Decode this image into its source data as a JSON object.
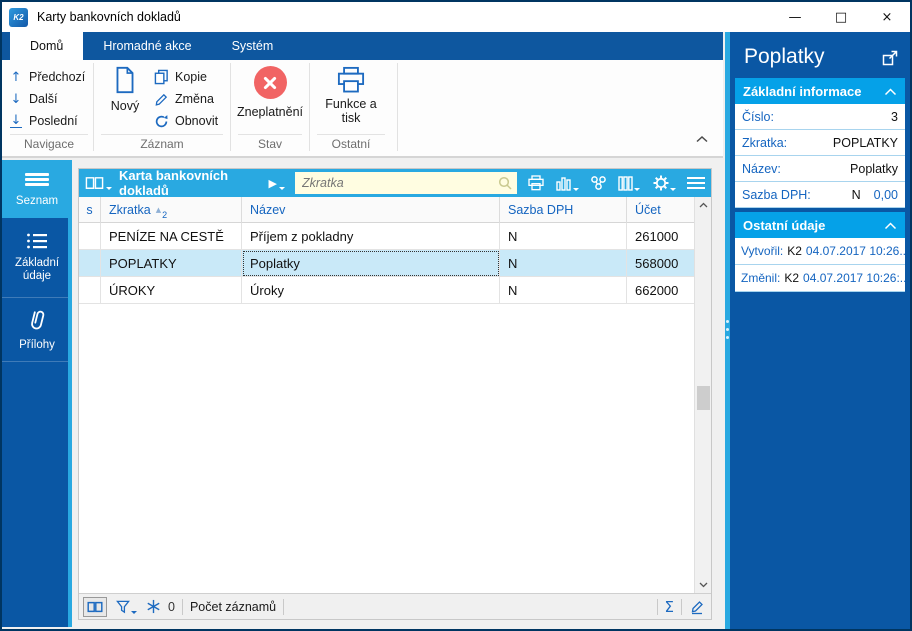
{
  "window": {
    "title": "Karty bankovních dokladů",
    "app_badge": "K2",
    "controls": {
      "minimize": "—",
      "maximize": "□",
      "close": "×"
    }
  },
  "ribbon": {
    "tabs": [
      {
        "label": "Domů"
      },
      {
        "label": "Hromadné akce"
      },
      {
        "label": "Systém"
      }
    ],
    "navigace": {
      "label": "Navigace",
      "prev": "Předchozí",
      "next": "Další",
      "last": "Poslední",
      "arrow_up": "↑",
      "arrow_down": "↓"
    },
    "zaznam": {
      "label": "Záznam",
      "new": "Nový",
      "copy": "Kopie",
      "change": "Změna",
      "refresh": "Obnovit"
    },
    "stav": {
      "label": "Stav",
      "invalidate": "Zneplatnění"
    },
    "ostatni": {
      "label": "Ostatní",
      "functions_line1": "Funkce a",
      "functions_line2": "tisk"
    }
  },
  "sidebar": {
    "items": [
      {
        "label": "Seznam",
        "icon": "hamburger-icon",
        "active": true
      },
      {
        "line1": "Základní",
        "line2": "údaje",
        "icon": "list-icon"
      },
      {
        "label": "Přílohy",
        "icon": "paperclip-icon"
      }
    ]
  },
  "grid": {
    "title": "Karta bankovních dokladů",
    "play_glyph": "▶",
    "search_placeholder": "Zkratka",
    "toolbar_icons": [
      "printer-icon",
      "chart-icon",
      "relations-icon",
      "columns-icon",
      "gear-icon",
      "menu-icon"
    ],
    "columns": {
      "s": "s",
      "zkratka": "Zkratka",
      "nazev": "Název",
      "sazba": "Sazba DPH",
      "ucet": "Účet"
    },
    "sort": {
      "column": "Zkratka",
      "direction": "asc",
      "arrow": "▲",
      "order": "2"
    },
    "rows": [
      {
        "s": "",
        "zkratka": "PENÍZE NA CESTĚ",
        "nazev": "Příjem z pokladny",
        "sazba_dph": "N",
        "ucet": "261000",
        "selected": false
      },
      {
        "s": "",
        "zkratka": "POPLATKY",
        "nazev": "Poplatky",
        "sazba_dph": "N",
        "ucet": "568000",
        "selected": true
      },
      {
        "s": "",
        "zkratka": "ÚROKY",
        "nazev": "Úroky",
        "sazba_dph": "N",
        "ucet": "662000",
        "selected": false
      }
    ],
    "status": {
      "frozen_count": "0",
      "count_label": "Počet záznamů",
      "sigma": "Σ"
    }
  },
  "panel": {
    "title": "Poplatky",
    "basic": {
      "title": "Základní informace",
      "rows": [
        {
          "label": "Číslo:",
          "value": "3"
        },
        {
          "label": "Zkratka:",
          "value": "POPLATKY"
        },
        {
          "label": "Název:",
          "value": "Poplatky"
        },
        {
          "label": "Sazba DPH:",
          "value": "N",
          "value2": "0,00"
        }
      ]
    },
    "other": {
      "title": "Ostatní údaje",
      "rows": [
        {
          "label": "Vytvořil:",
          "user": "K2",
          "date": "04.07.2017 10:26..."
        },
        {
          "label": "Změnil:",
          "user": "K2",
          "date": "04.07.2017 10:26:..."
        }
      ]
    }
  },
  "colors": {
    "accent_cyan": "#29A9E1",
    "card_header_cyan": "#05A1E8",
    "dark_blue": "#0A57A4",
    "tabbar_blue": "#0E579F",
    "label_blue": "#1565C0",
    "icon_blue": "#1D6AC0",
    "invalidate_red": "#F16464",
    "selection": "#C9E9F8",
    "search_bg": "#FFFDE1",
    "window_border": "#003561"
  }
}
